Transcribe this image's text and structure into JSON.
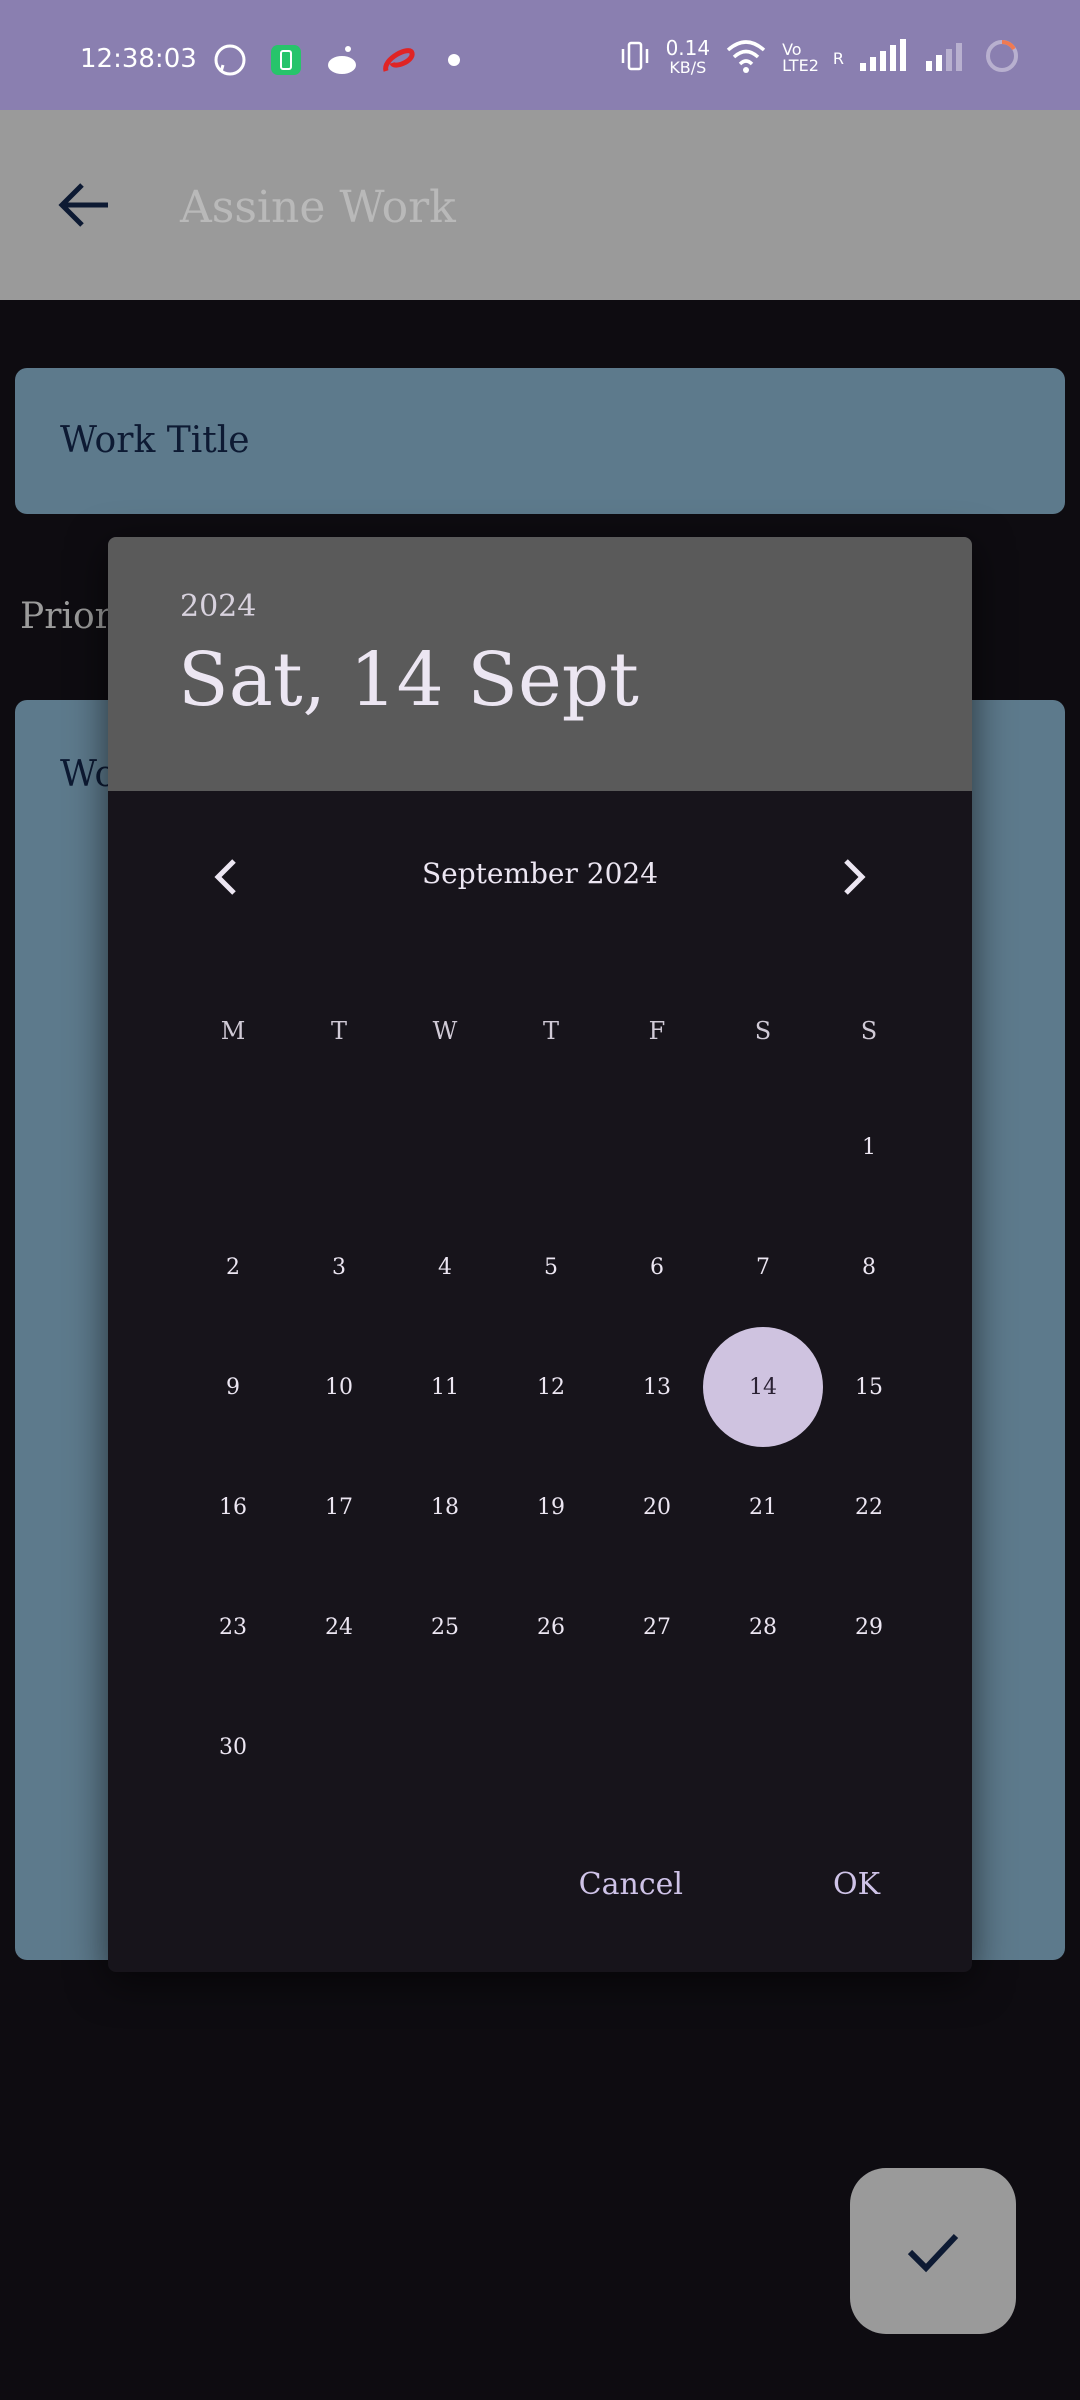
{
  "status_bar": {
    "time": "12:38:03",
    "speed_value": "0.14",
    "speed_unit": "KB/S",
    "volte_top": "Vo",
    "volte_bottom": "LTE2",
    "roaming": "R",
    "icons": [
      "whatsapp-icon",
      "battery-saver-icon",
      "reddit-icon",
      "airtel-icon",
      "dot-icon",
      "vibrate-icon",
      "wifi-icon",
      "signal-icon",
      "signal-2-icon",
      "loading-ring-icon"
    ]
  },
  "app_bar": {
    "title": "Assine Work"
  },
  "form": {
    "work_title_label": "Work Title",
    "priority_label": "Prior",
    "work_label": "Wo"
  },
  "date_picker": {
    "header_year": "2024",
    "header_date": "Sat, 14 Sept",
    "month_label": "September 2024",
    "weekdays": [
      "M",
      "T",
      "W",
      "T",
      "F",
      "S",
      "S"
    ],
    "weeks": [
      [
        "",
        "",
        "",
        "",
        "",
        "",
        "1"
      ],
      [
        "2",
        "3",
        "4",
        "5",
        "6",
        "7",
        "8"
      ],
      [
        "9",
        "10",
        "11",
        "12",
        "13",
        "14",
        "15"
      ],
      [
        "16",
        "17",
        "18",
        "19",
        "20",
        "21",
        "22"
      ],
      [
        "23",
        "24",
        "25",
        "26",
        "27",
        "28",
        "29"
      ],
      [
        "30",
        "",
        "",
        "",
        "",
        "",
        ""
      ]
    ],
    "selected_day": "14",
    "cancel_label": "Cancel",
    "ok_label": "OK",
    "accent_color": "#cfc3e0"
  }
}
